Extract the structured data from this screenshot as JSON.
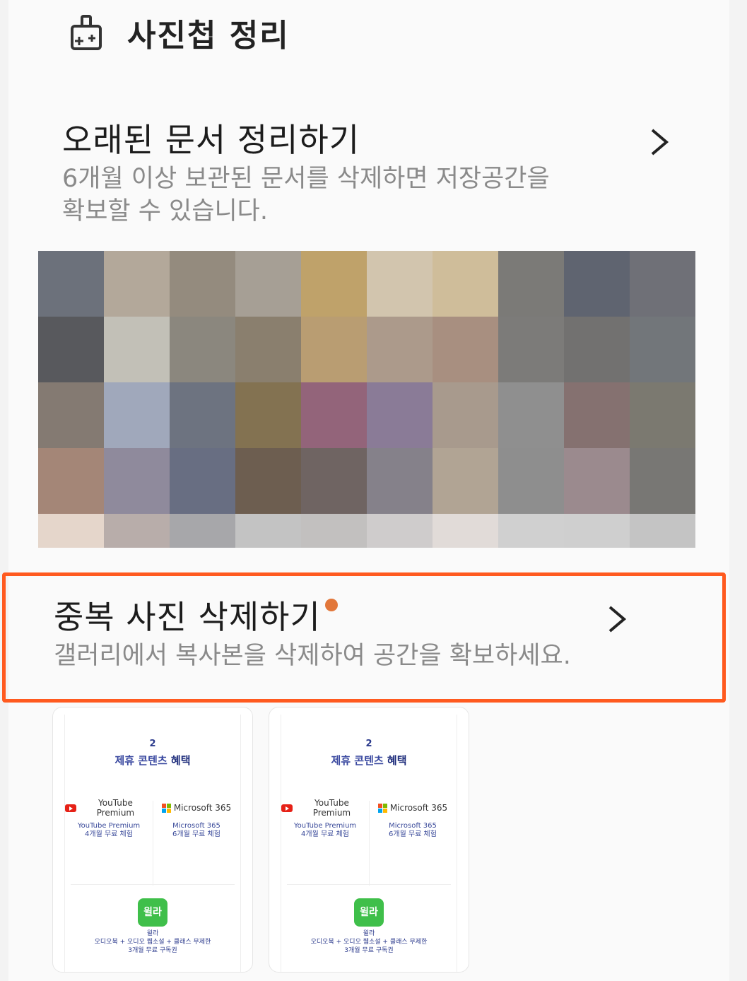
{
  "header": {
    "title": "사진첩 정리",
    "icon": "broom-icon"
  },
  "old_docs": {
    "title": "오래된 문서 정리하기",
    "description_line1": "6개월 이상 보관된 문서를 삭제하면 저장공간을",
    "description_line2": "확보할 수 있습니다."
  },
  "duplicates": {
    "title": "중복 사진 삭제하기",
    "description": "갤러리에서 복사본을 삭제하여 공간을 확보하세요."
  },
  "thumbnails": [
    {
      "number": "2",
      "heading_a": "제휴 콘텐츠 ",
      "heading_b": "혜택",
      "left_logo": "YouTube Premium",
      "left_sub1": "YouTube Premium",
      "left_sub2": "4개월 무료 체험",
      "right_logo": "Microsoft 365",
      "right_sub1": "Microsoft 365",
      "right_sub2": "6개월 무료 체험",
      "badge": "윌라",
      "bottom1": "윌라",
      "bottom2": "오디오북 + 오디오 웹소설 + 클래스 무제한",
      "bottom3": "3개월 무료 구독권"
    },
    {
      "number": "2",
      "heading_a": "제휴 콘텐츠 ",
      "heading_b": "혜택",
      "left_logo": "YouTube Premium",
      "left_sub1": "YouTube Premium",
      "left_sub2": "4개월 무료 체험",
      "right_logo": "Microsoft 365",
      "right_sub1": "Microsoft 365",
      "right_sub2": "6개월 무료 체험",
      "badge": "윌라",
      "bottom1": "윌라",
      "bottom2": "오디오북 + 오디오 웹소설 + 클래스 무제한",
      "bottom3": "3개월 무료 구독권"
    }
  ],
  "colors": {
    "accent": "#ff5a1f",
    "dot": "#e2773a"
  },
  "mosaic_colors": [
    "#6c717b",
    "#b3a89a",
    "#948b7e",
    "#a69f95",
    "#bfa26a",
    "#d2c5ae",
    "#cfbd9a",
    "#7b7a77",
    "#5f6470",
    "#6f7077",
    "#58595d",
    "#c2c0b7",
    "#8b877e",
    "#8a7f6e",
    "#b99d72",
    "#ac9a8b",
    "#a88f80",
    "#7c7b79",
    "#727170",
    "#72767a",
    "#847a72",
    "#a0a8bb",
    "#6d7380",
    "#837251",
    "#93647a",
    "#8a7b97",
    "#a89a8d",
    "#8f8f8f",
    "#857170",
    "#7b7970",
    "#a48677",
    "#8f8a9c",
    "#686e82",
    "#6d5e50",
    "#6f6462",
    "#85818a",
    "#b1a494",
    "#8e8e8e",
    "#9b8a8e",
    "#787774",
    "#e5d6cb",
    "#b8adaa",
    "#a7a7aa",
    "#c3c3c3",
    "#c2c0bf",
    "#cfcccc",
    "#e1dbd8",
    "#d0d0d0",
    "#cfcfcf",
    "#c4c4c4"
  ]
}
